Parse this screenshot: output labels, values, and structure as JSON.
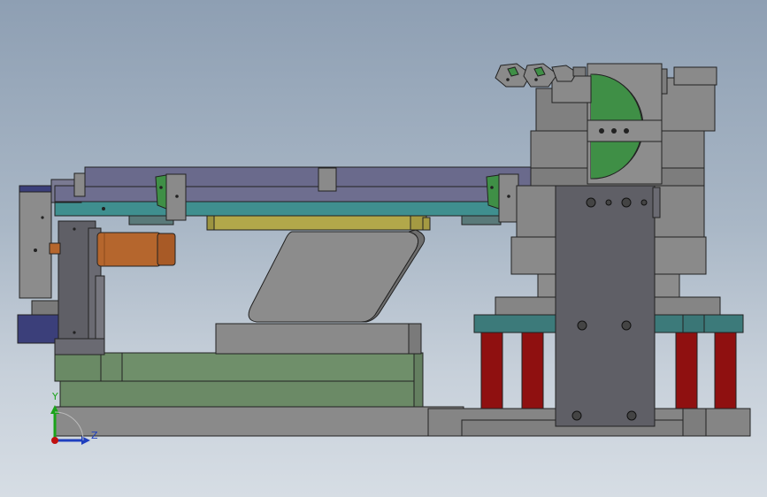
{
  "viewport": {
    "view": "cad-3d-model",
    "background_top": "#8e9fb3",
    "background_bottom": "#d6dde4"
  },
  "colors": {
    "steel_gray": "#808080",
    "dark_gray": "#5f5f66",
    "slate_blue": "#6e6e8f",
    "teal_rail": "#3f8f8f",
    "olive_bar": "#b2a84a",
    "green_plate": "#6f8f6a",
    "copper_cylinder": "#b5662d",
    "red_column": "#8f1010",
    "teal_block": "#3c7a7a",
    "navy_block": "#3b3f7a",
    "green_gripper": "#3f8f46"
  },
  "triad": {
    "y_label": "Y",
    "z_label": "Z",
    "y_color": "#1aa31a",
    "z_color": "#1f3fbf",
    "origin_color": "#c01010"
  }
}
